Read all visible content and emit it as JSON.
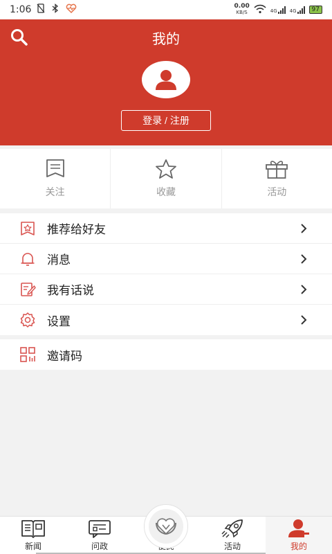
{
  "status_bar": {
    "time": "1:06",
    "net_speed_value": "0.00",
    "net_speed_unit": "KB/S",
    "signal_label_1": "4G",
    "signal_label_2": "4G",
    "battery": "97"
  },
  "header": {
    "title": "我的",
    "login_label": "登录 / 注册"
  },
  "quick_actions": [
    {
      "label": "关注",
      "icon": "bookmark-icon"
    },
    {
      "label": "收藏",
      "icon": "star-icon"
    },
    {
      "label": "活动",
      "icon": "gift-icon"
    }
  ],
  "menu": [
    {
      "label": "推荐给好友",
      "icon": "star-badge-icon"
    },
    {
      "label": "消息",
      "icon": "bell-icon"
    },
    {
      "label": "我有话说",
      "icon": "edit-icon"
    },
    {
      "label": "设置",
      "icon": "gear-icon"
    }
  ],
  "menu2": [
    {
      "label": "邀请码",
      "icon": "qr-code-icon"
    }
  ],
  "tabs": [
    {
      "label": "新闻",
      "icon": "newspaper-icon"
    },
    {
      "label": "问政",
      "icon": "inquiry-icon"
    },
    {
      "label": "便民",
      "icon": "heart-hands-icon"
    },
    {
      "label": "活动",
      "icon": "rocket-icon"
    },
    {
      "label": "我的",
      "icon": "user-icon",
      "active": true
    }
  ],
  "colors": {
    "brand_red": "#cf3b2c",
    "icon_gray": "#666666",
    "menu_icon_red": "#d9534f"
  }
}
